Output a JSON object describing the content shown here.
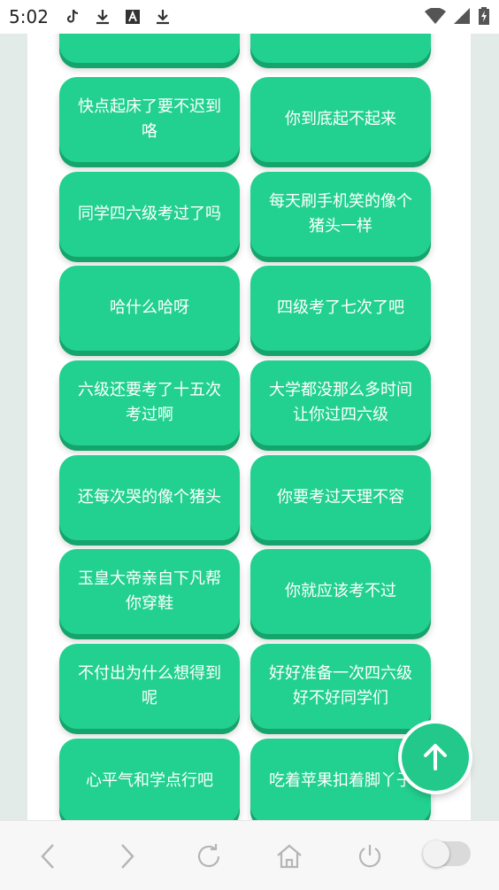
{
  "status_bar": {
    "time": "5:02",
    "left_icons": [
      "tiktok-icon",
      "download-icon",
      "a-icon",
      "download-icon"
    ],
    "right_icons": [
      "wifi-icon",
      "signal-icon",
      "battery-charging-icon"
    ]
  },
  "cards": [
    {
      "text": ""
    },
    {
      "text": ""
    },
    {
      "text": "快点起床了要不迟到咯"
    },
    {
      "text": "你到底起不起来"
    },
    {
      "text": "同学四六级考过了吗"
    },
    {
      "text": "每天刷手机笑的像个猪头一样"
    },
    {
      "text": "哈什么哈呀"
    },
    {
      "text": "四级考了七次了吧"
    },
    {
      "text": "六级还要考了十五次考过啊"
    },
    {
      "text": "大学都没那么多时间让你过四六级"
    },
    {
      "text": "还每次哭的像个猪头"
    },
    {
      "text": "你要考过天理不容"
    },
    {
      "text": "玉皇大帝亲自下凡帮你穿鞋"
    },
    {
      "text": "你就应该考不过"
    },
    {
      "text": "不付出为什么想得到呢"
    },
    {
      "text": "好好准备一次四六级好不好同学们"
    },
    {
      "text": "心平气和学点行吧"
    },
    {
      "text": "吃着苹果扣着脚丫子"
    },
    {
      "text": ""
    },
    {
      "text": ""
    }
  ],
  "fab": {
    "icon": "arrow-up-icon"
  },
  "bottom_nav": {
    "items": [
      "back-icon",
      "forward-icon",
      "refresh-icon",
      "home-icon",
      "power-icon"
    ],
    "toggle_state": "off"
  },
  "colors": {
    "card": "#22d18f",
    "card_shadow": "#14a46c",
    "side_background": "#e3ebe8",
    "fab": "#22c98a"
  }
}
